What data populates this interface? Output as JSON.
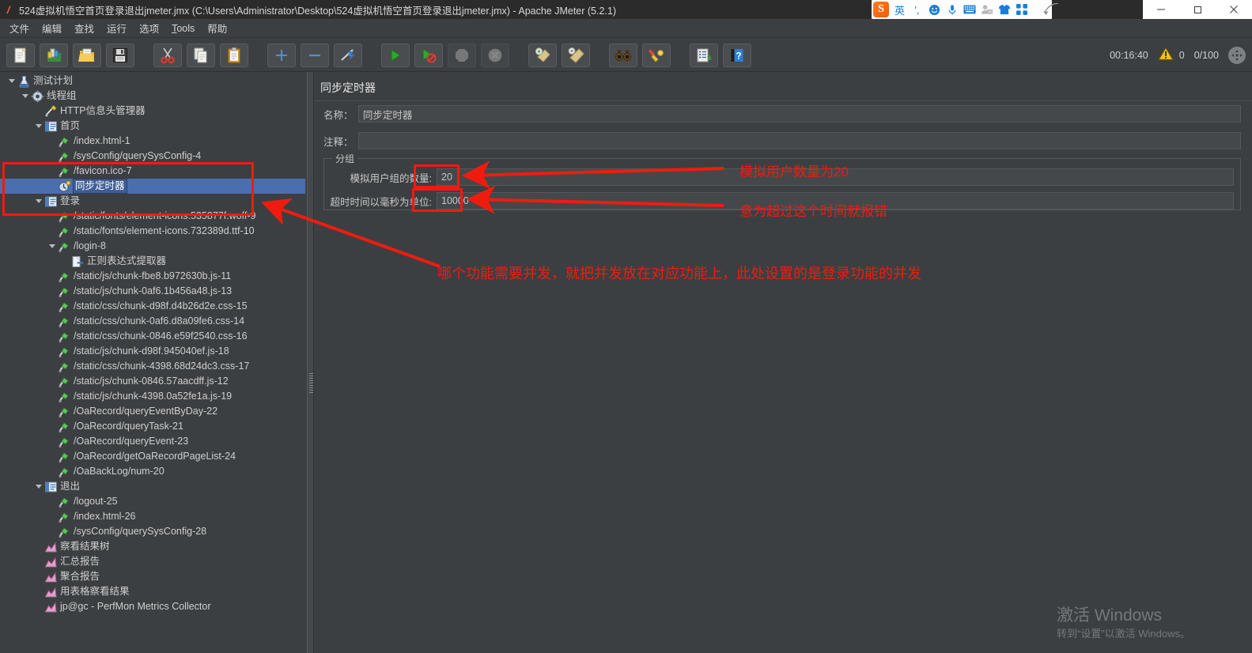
{
  "window": {
    "title": "524虚拟机悟空首页登录退出jmeter.jmx (C:\\Users\\Administrator\\Desktop\\524虚拟机悟空首页登录退出jmeter.jmx) - Apache JMeter (5.2.1)",
    "app_icon": "jmeter-feather-icon",
    "minimize": "minimize-icon",
    "maximize": "maximize-icon",
    "close": "close-icon"
  },
  "ime": {
    "logo": "sogou-logo",
    "items": [
      {
        "name": "ime-mode-chinese",
        "glyph": "英"
      },
      {
        "name": "ime-punctuation",
        "glyph": "′,"
      },
      {
        "name": "ime-emoji",
        "glyph": "☺"
      },
      {
        "name": "ime-voice",
        "glyph": "🎤"
      },
      {
        "name": "ime-soft-keyboard",
        "glyph": "⌨"
      },
      {
        "name": "ime-user",
        "glyph": "👤"
      },
      {
        "name": "ime-skin",
        "glyph": "👕"
      },
      {
        "name": "ime-toolbox",
        "glyph": "▦"
      }
    ]
  },
  "menubar": {
    "items": [
      {
        "label": "文件",
        "name": "menu-file"
      },
      {
        "label": "编辑",
        "name": "menu-edit"
      },
      {
        "label": "查找",
        "name": "menu-search"
      },
      {
        "label": "运行",
        "name": "menu-run"
      },
      {
        "label": "选项",
        "name": "menu-options"
      },
      {
        "label": "Tools",
        "name": "menu-tools",
        "mnemonic": "T"
      },
      {
        "label": "帮助",
        "name": "menu-help"
      }
    ]
  },
  "toolbar": {
    "buttons": [
      {
        "name": "new-button",
        "icon": "new-document-icon",
        "enabled": true
      },
      {
        "name": "templates-button",
        "icon": "templates-icon",
        "enabled": true
      },
      {
        "name": "open-button",
        "icon": "open-folder-icon",
        "enabled": true
      },
      {
        "name": "save-button",
        "icon": "save-floppy-icon",
        "enabled": true
      },
      {
        "name": "cut-button",
        "icon": "scissors-icon",
        "enabled": true
      },
      {
        "name": "copy-button",
        "icon": "copy-icon",
        "enabled": true
      },
      {
        "name": "paste-button",
        "icon": "clipboard-paste-icon",
        "enabled": true
      },
      {
        "name": "expand-all-button",
        "icon": "plus-icon",
        "enabled": true
      },
      {
        "name": "collapse-all-button",
        "icon": "minus-icon",
        "enabled": true
      },
      {
        "name": "toggle-button",
        "icon": "toggle-pencil-icon",
        "enabled": true
      },
      {
        "name": "start-button",
        "icon": "play-green-icon",
        "enabled": true
      },
      {
        "name": "start-no-pauses-button",
        "icon": "play-no-pause-icon",
        "enabled": true
      },
      {
        "name": "stop-button",
        "icon": "stop-icon",
        "enabled": false
      },
      {
        "name": "shutdown-button",
        "icon": "shutdown-icon",
        "enabled": false
      },
      {
        "name": "clear-button",
        "icon": "clear-broom-icon",
        "enabled": true
      },
      {
        "name": "clear-all-button",
        "icon": "clear-all-broom-icon",
        "enabled": true
      },
      {
        "name": "search-button",
        "icon": "binoculars-icon",
        "enabled": true
      },
      {
        "name": "reset-search-button",
        "icon": "reset-search-icon",
        "enabled": true
      },
      {
        "name": "function-helper-button",
        "icon": "function-helper-icon",
        "enabled": true
      },
      {
        "name": "help-button",
        "icon": "help-book-icon",
        "enabled": true
      }
    ],
    "status": {
      "timer": "00:16:40",
      "warning_icon": "warning-triangle-icon",
      "warning_count": "0",
      "threads": "0/100",
      "grid_icon": "grid-expand-icon"
    }
  },
  "tree": {
    "nodes": [
      {
        "label": "测试计划",
        "indent": 0,
        "twisty": "open",
        "icon": "test-plan-icon",
        "name": "tree-node-test-plan"
      },
      {
        "label": "线程组",
        "indent": 1,
        "twisty": "open",
        "icon": "thread-group-icon",
        "name": "tree-node-thread-group"
      },
      {
        "label": "HTTP信息头管理器",
        "indent": 2,
        "twisty": "none",
        "icon": "header-manager-icon",
        "name": "tree-node-http-header-manager"
      },
      {
        "label": "首页",
        "indent": 2,
        "twisty": "open",
        "icon": "transaction-controller-icon",
        "name": "tree-node-home"
      },
      {
        "label": "/index.html-1",
        "indent": 3,
        "twisty": "none",
        "icon": "http-sampler-icon",
        "name": "tree-node-index-html-1"
      },
      {
        "label": "/sysConfig/querySysConfig-4",
        "indent": 3,
        "twisty": "none",
        "icon": "http-sampler-icon",
        "name": "tree-node-sysconfig-4"
      },
      {
        "label": "/favicon.ico-7",
        "indent": 3,
        "twisty": "none",
        "icon": "http-sampler-icon",
        "name": "tree-node-favicon-7"
      },
      {
        "label": "同步定时器",
        "indent": 3,
        "twisty": "none",
        "icon": "sync-timer-icon",
        "name": "tree-node-sync-timer",
        "selected": true
      },
      {
        "label": "登录",
        "indent": 2,
        "twisty": "open",
        "icon": "transaction-controller-icon",
        "name": "tree-node-login"
      },
      {
        "label": "/static/fonts/element-icons.535877f.woff-9",
        "indent": 3,
        "twisty": "none",
        "icon": "http-sampler-icon",
        "name": "tree-node-woff-9"
      },
      {
        "label": "/static/fonts/element-icons.732389d.ttf-10",
        "indent": 3,
        "twisty": "none",
        "icon": "http-sampler-icon",
        "name": "tree-node-ttf-10"
      },
      {
        "label": "/login-8",
        "indent": 3,
        "twisty": "open",
        "icon": "http-sampler-icon",
        "name": "tree-node-login-8"
      },
      {
        "label": "正则表达式提取器",
        "indent": 4,
        "twisty": "none",
        "icon": "regex-extractor-icon",
        "name": "tree-node-regex-extractor"
      },
      {
        "label": "/static/js/chunk-fbe8.b972630b.js-11",
        "indent": 3,
        "twisty": "none",
        "icon": "http-sampler-icon",
        "name": "tree-node-js-11"
      },
      {
        "label": "/static/js/chunk-0af6.1b456a48.js-13",
        "indent": 3,
        "twisty": "none",
        "icon": "http-sampler-icon",
        "name": "tree-node-js-13"
      },
      {
        "label": "/static/css/chunk-d98f.d4b26d2e.css-15",
        "indent": 3,
        "twisty": "none",
        "icon": "http-sampler-icon",
        "name": "tree-node-css-15"
      },
      {
        "label": "/static/css/chunk-0af6.d8a09fe6.css-14",
        "indent": 3,
        "twisty": "none",
        "icon": "http-sampler-icon",
        "name": "tree-node-css-14"
      },
      {
        "label": "/static/css/chunk-0846.e59f2540.css-16",
        "indent": 3,
        "twisty": "none",
        "icon": "http-sampler-icon",
        "name": "tree-node-css-16"
      },
      {
        "label": "/static/js/chunk-d98f.945040ef.js-18",
        "indent": 3,
        "twisty": "none",
        "icon": "http-sampler-icon",
        "name": "tree-node-js-18"
      },
      {
        "label": "/static/css/chunk-4398.68d24dc3.css-17",
        "indent": 3,
        "twisty": "none",
        "icon": "http-sampler-icon",
        "name": "tree-node-css-17"
      },
      {
        "label": "/static/js/chunk-0846.57aacdff.js-12",
        "indent": 3,
        "twisty": "none",
        "icon": "http-sampler-icon",
        "name": "tree-node-js-12"
      },
      {
        "label": "/static/js/chunk-4398.0a52fe1a.js-19",
        "indent": 3,
        "twisty": "none",
        "icon": "http-sampler-icon",
        "name": "tree-node-js-19"
      },
      {
        "label": "/OaRecord/queryEventByDay-22",
        "indent": 3,
        "twisty": "none",
        "icon": "http-sampler-icon",
        "name": "tree-node-queryeventbyday-22"
      },
      {
        "label": "/OaRecord/queryTask-21",
        "indent": 3,
        "twisty": "none",
        "icon": "http-sampler-icon",
        "name": "tree-node-querytask-21"
      },
      {
        "label": "/OaRecord/queryEvent-23",
        "indent": 3,
        "twisty": "none",
        "icon": "http-sampler-icon",
        "name": "tree-node-queryevent-23"
      },
      {
        "label": "/OaRecord/getOaRecordPageList-24",
        "indent": 3,
        "twisty": "none",
        "icon": "http-sampler-icon",
        "name": "tree-node-getoarecordpagelist-24"
      },
      {
        "label": "/OaBackLog/num-20",
        "indent": 3,
        "twisty": "none",
        "icon": "http-sampler-icon",
        "name": "tree-node-oabacklog-num-20"
      },
      {
        "label": "退出",
        "indent": 2,
        "twisty": "open",
        "icon": "transaction-controller-icon",
        "name": "tree-node-logout-group"
      },
      {
        "label": "/logout-25",
        "indent": 3,
        "twisty": "none",
        "icon": "http-sampler-icon",
        "name": "tree-node-logout-25"
      },
      {
        "label": "/index.html-26",
        "indent": 3,
        "twisty": "none",
        "icon": "http-sampler-icon",
        "name": "tree-node-index-html-26"
      },
      {
        "label": "/sysConfig/querySysConfig-28",
        "indent": 3,
        "twisty": "none",
        "icon": "http-sampler-icon",
        "name": "tree-node-sysconfig-28"
      },
      {
        "label": "察看结果树",
        "indent": 2,
        "twisty": "none",
        "icon": "view-results-tree-icon",
        "name": "tree-node-view-results-tree"
      },
      {
        "label": "汇总报告",
        "indent": 2,
        "twisty": "none",
        "icon": "summary-report-icon",
        "name": "tree-node-summary-report"
      },
      {
        "label": "聚合报告",
        "indent": 2,
        "twisty": "none",
        "icon": "aggregate-report-icon",
        "name": "tree-node-aggregate-report"
      },
      {
        "label": "用表格察看结果",
        "indent": 2,
        "twisty": "none",
        "icon": "view-results-table-icon",
        "name": "tree-node-view-results-table"
      },
      {
        "label": "jp@gc - PerfMon Metrics Collector",
        "indent": 2,
        "twisty": "none",
        "icon": "perfmon-collector-icon",
        "name": "tree-node-perfmon-collector"
      }
    ]
  },
  "detail": {
    "title": "同步定时器",
    "name_label": "名称：",
    "name_value": "同步定时器",
    "comment_label": "注释：",
    "comment_value": "",
    "group_legend": "分组",
    "users_label": "模拟用户组的数量:",
    "users_value": "20",
    "timeout_label": "超时时间以毫秒为单位:",
    "timeout_value": "10000"
  },
  "annotations": [
    {
      "name": "annotation-users-count",
      "text": "模拟用户数量为20"
    },
    {
      "name": "annotation-timeout",
      "text": "意为超过这个时间就报错"
    },
    {
      "name": "annotation-concurrency",
      "text": "哪个功能需要并发，就把并发放在对应功能上，此处设置的是登录功能的并发"
    }
  ],
  "watermark": {
    "line1": "激活 Windows",
    "line2": "转到“设置”以激活 Windows。"
  },
  "colors": {
    "panel_bg": "#3c3f41",
    "titlebar_bg": "#2b2b2b",
    "selection_blue": "#4b6eaf",
    "annotation_red": "#f01b0f",
    "field_bg": "#45484a",
    "text": "#cfcfcf"
  }
}
